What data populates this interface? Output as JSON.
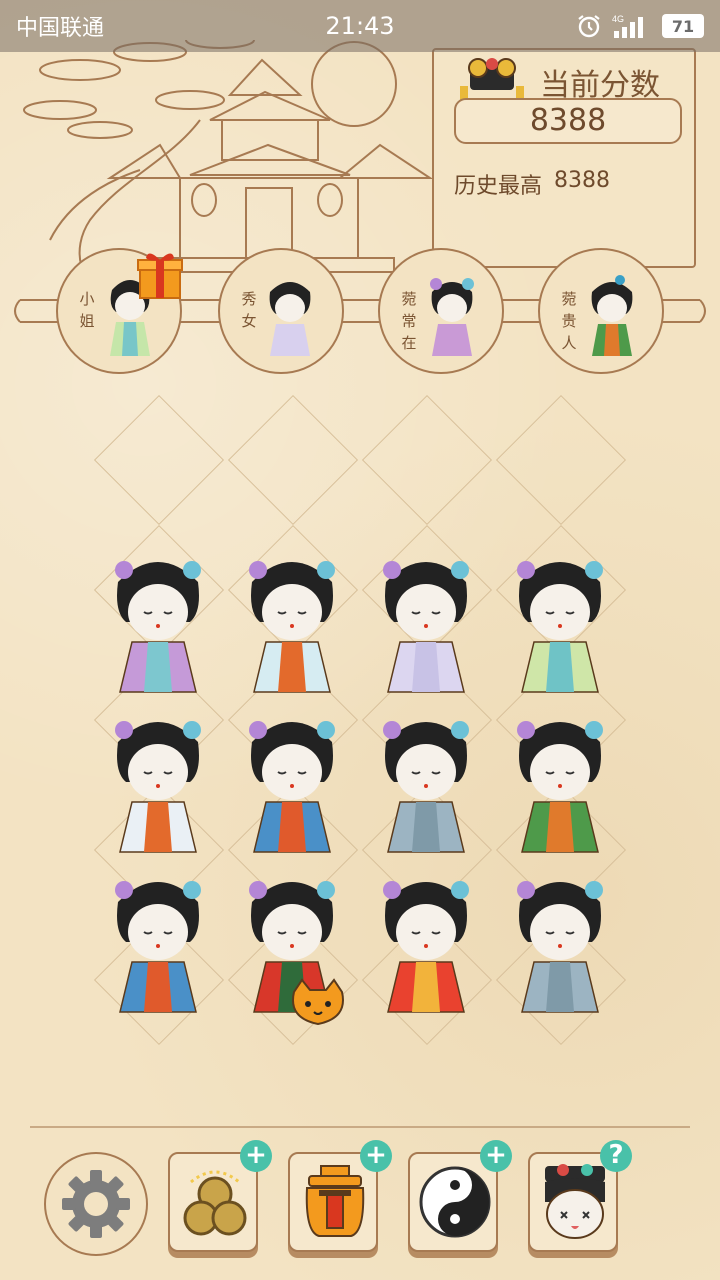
{
  "status_bar": {
    "carrier": "中国联通",
    "time": "21:43",
    "network": "4G",
    "battery": "71"
  },
  "score": {
    "title": "当前分数",
    "current": "8388",
    "best_label": "历史最高",
    "best": "8388"
  },
  "ranks": [
    {
      "label": "小姐"
    },
    {
      "label": "秀女"
    },
    {
      "label": "菀常在"
    },
    {
      "label": "菀贵人"
    }
  ],
  "tools": [
    {
      "name": "coins",
      "badge": "+"
    },
    {
      "name": "lantern",
      "badge": "+"
    },
    {
      "name": "yin-yang",
      "badge": "+"
    },
    {
      "name": "doll-help",
      "badge": "?"
    }
  ],
  "colors": {
    "background": "#f3e3c3",
    "line": "#a77a52",
    "badge": "#49c1a9"
  }
}
